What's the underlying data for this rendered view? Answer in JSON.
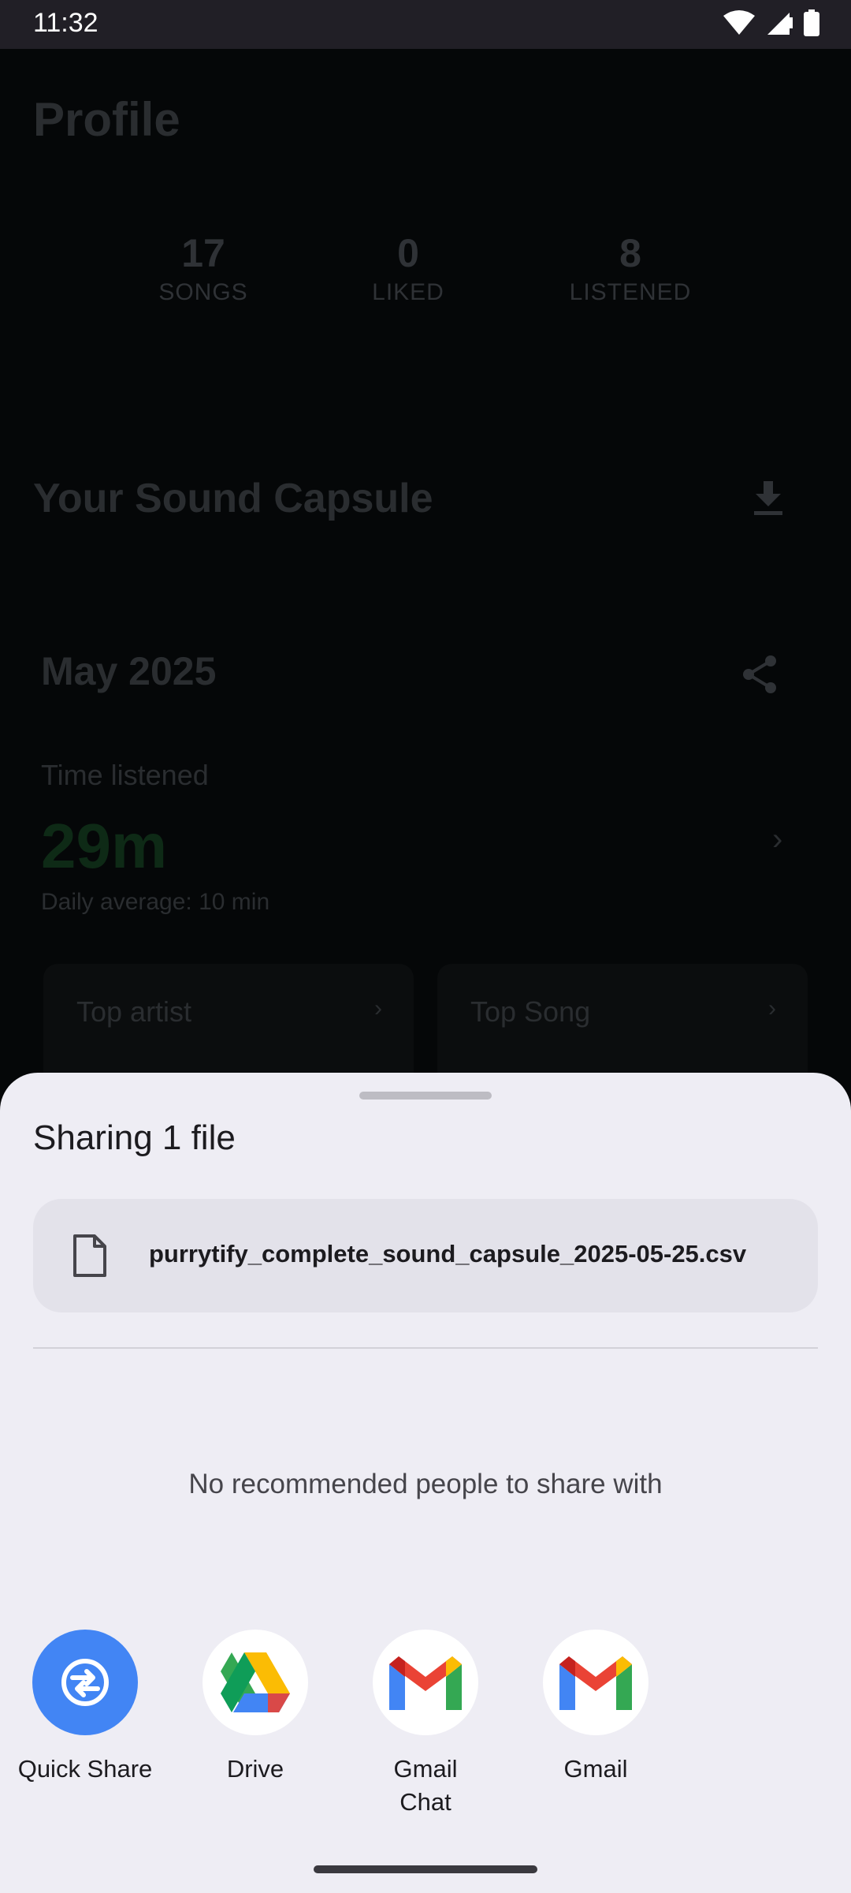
{
  "status_bar": {
    "time": "11:32"
  },
  "profile": {
    "title": "Profile",
    "stats": [
      {
        "value": "17",
        "label": "SONGS"
      },
      {
        "value": "0",
        "label": "LIKED"
      },
      {
        "value": "8",
        "label": "LISTENED"
      }
    ]
  },
  "sound_capsule": {
    "title": "Your Sound Capsule",
    "month": "May 2025",
    "time_listened_label": "Time listened",
    "time_listened_value": "29m",
    "daily_average": "Daily average: 10 min",
    "cards": [
      {
        "title": "Top artist"
      },
      {
        "title": "Top Song"
      }
    ]
  },
  "share_sheet": {
    "title": "Sharing 1 file",
    "file_name": "purrytify_complete_sound_capsule_2025-05-25.csv",
    "no_recommended": "No recommended people to share with",
    "targets": [
      {
        "name": "Quick Share",
        "icon": "quick-share-icon"
      },
      {
        "name": "Drive",
        "icon": "google-drive-icon"
      },
      {
        "name": "Gmail\nChat",
        "icon": "gmail-icon"
      },
      {
        "name": "Gmail",
        "icon": "gmail-icon"
      }
    ]
  }
}
